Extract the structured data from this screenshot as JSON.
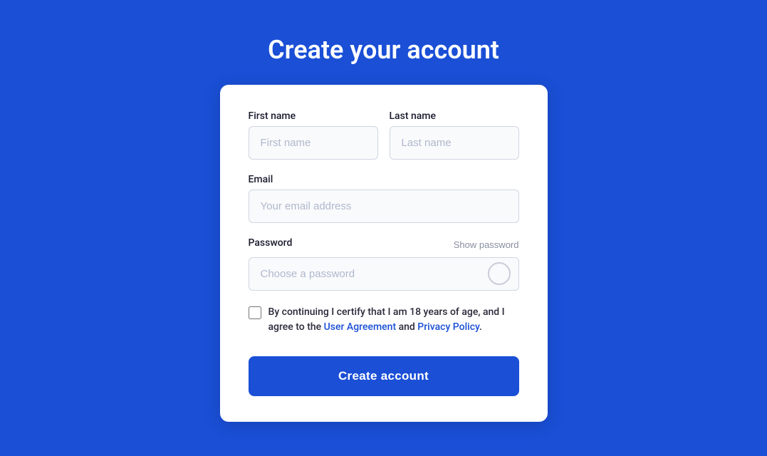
{
  "page": {
    "title": "Create your account",
    "background_color": "#1a4fd6"
  },
  "form": {
    "first_name_label": "First name",
    "first_name_placeholder": "First name",
    "last_name_label": "Last name",
    "last_name_placeholder": "Last name",
    "email_label": "Email",
    "email_placeholder": "Your email address",
    "password_label": "Password",
    "password_placeholder": "Choose a password",
    "show_password_label": "Show password",
    "certify_text_before": "By continuing I certify that I am 18 years of age, and I agree to the ",
    "user_agreement_label": "User Agreement",
    "certify_text_mid": " and ",
    "privacy_policy_label": "Privacy Policy",
    "certify_text_end": ".",
    "submit_label": "Create account"
  }
}
